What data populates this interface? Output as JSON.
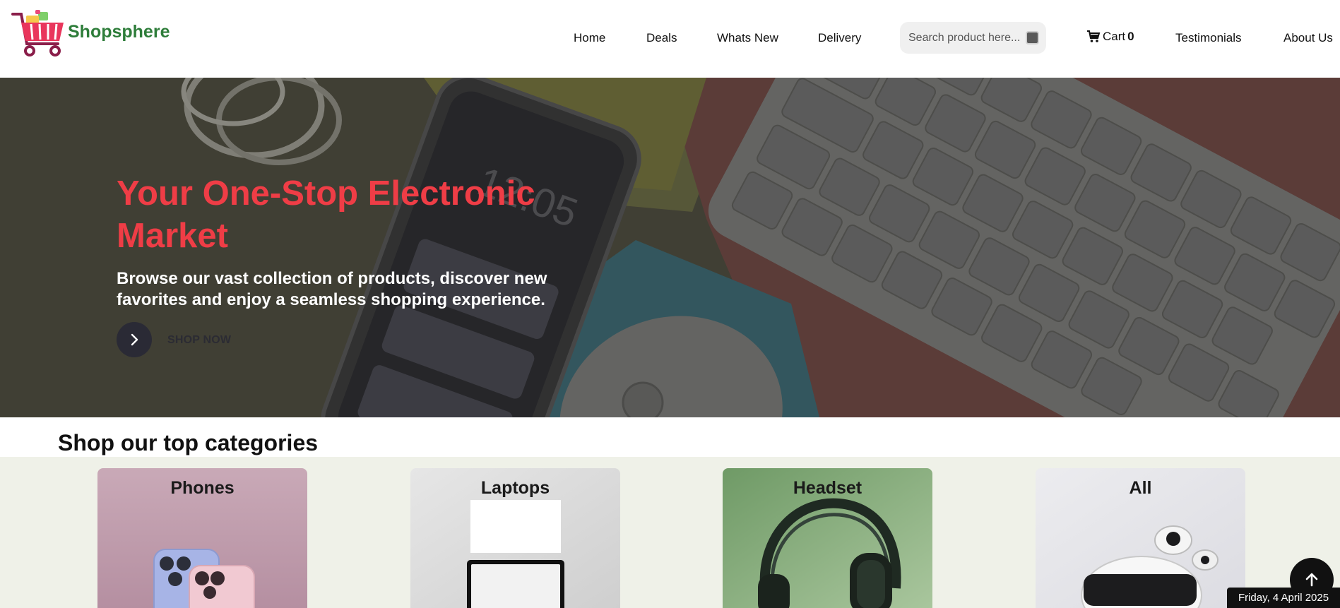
{
  "brand": {
    "name": "Shopsphere",
    "logo_icon": "shopping-cart-icon"
  },
  "nav": {
    "items": [
      {
        "label": "Home"
      },
      {
        "label": "Deals"
      },
      {
        "label": "Whats New"
      },
      {
        "label": "Delivery"
      }
    ],
    "search": {
      "placeholder": "Search product here...",
      "icon": "search-icon"
    },
    "cart": {
      "label": "Cart",
      "count": "0",
      "icon": "cart-icon"
    },
    "items_right": [
      {
        "label": "Testimonials"
      },
      {
        "label": "About Us"
      }
    ]
  },
  "hero": {
    "title": "Your One-Stop Electronic Market",
    "subtitle": "Browse our vast collection of products, discover new favorites and enjoy a seamless shopping experience.",
    "cta_label": "SHOP NOW",
    "cta_icon": "chevron-right-icon"
  },
  "categories": {
    "heading": "Shop our top categories",
    "items": [
      {
        "title": "Phones"
      },
      {
        "title": "Laptops"
      },
      {
        "title": "Headset"
      },
      {
        "title": "All"
      }
    ]
  },
  "footer": {
    "back_to_top_icon": "arrow-up-icon",
    "date": "Friday, 4 April 2025"
  },
  "colors": {
    "accent_red": "#ef3d46",
    "brand_green": "#2e7d3a",
    "category_band": "#eff1e8"
  }
}
